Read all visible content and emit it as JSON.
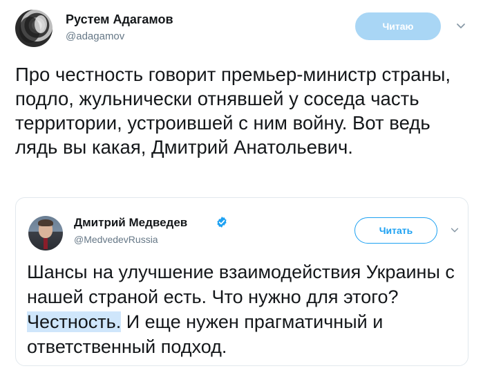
{
  "tweet": {
    "author_name": "Рустем Адагамов",
    "author_handle": "@adagamov",
    "follow_label": "Читаю",
    "text": "Про честность говорит премьер-министр страны, подло, жульнически отнявшей у соседа часть территории, устроившей с ним войну. Вот ведь лядь вы какая, Дмитрий Анатольевич."
  },
  "quoted_tweet": {
    "author_name": "Дмитрий Медведев",
    "author_handle": "@MedvedevRussia",
    "follow_label": "Читать",
    "text_before": "Шансы на улучшение взаимодействия Украины с нашей страной есть. Что нужно для этого? ",
    "text_highlight": "Честность.",
    "text_after": " И еще нужен прагматичный и ответственный подход."
  },
  "icons": {
    "menu_caret": "chevron-down-icon",
    "verified": "verified-badge-icon"
  },
  "colors": {
    "text": "#14171a",
    "secondary": "#657786",
    "follow_active_bg": "#a9d6f5",
    "brand_blue": "#1da1f2",
    "highlight": "#cfe6fb",
    "border": "#e1e8ed"
  }
}
